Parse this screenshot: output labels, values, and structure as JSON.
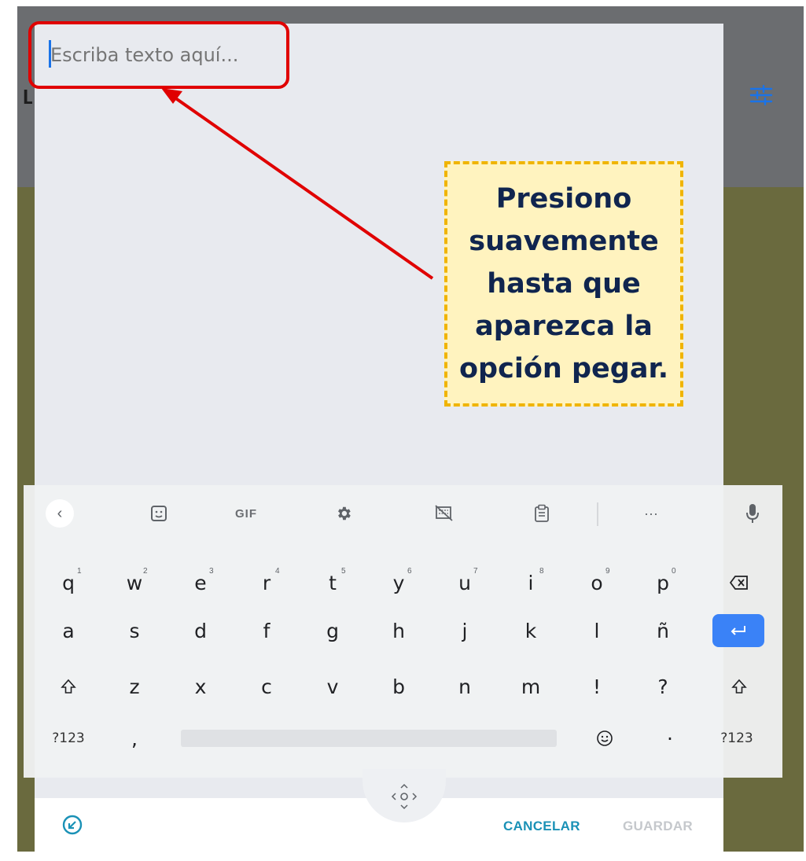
{
  "input": {
    "placeholder": "Escriba texto aquí..."
  },
  "callout": {
    "text": "Presiono suavemente hasta que aparezca la opción pegar."
  },
  "toolbar": {
    "gif_label": "GIF",
    "more_label": "···",
    "icons": [
      "chevron-left-icon",
      "sticker-icon",
      "gif-icon",
      "gear-icon",
      "keyboard-resize-icon",
      "clipboard-icon",
      "more-icon",
      "microphone-icon"
    ]
  },
  "keyboard": {
    "row1": [
      "q",
      "w",
      "e",
      "r",
      "t",
      "y",
      "u",
      "i",
      "o",
      "p"
    ],
    "row1_hints": [
      "1",
      "2",
      "3",
      "4",
      "5",
      "6",
      "7",
      "8",
      "9",
      "0"
    ],
    "row2": [
      "a",
      "s",
      "d",
      "f",
      "g",
      "h",
      "j",
      "k",
      "l",
      "ñ"
    ],
    "row3": [
      "z",
      "x",
      "c",
      "v",
      "b",
      "n",
      "m",
      "!",
      "?"
    ],
    "row4": {
      "symbols_left": "?123",
      "comma": ",",
      "period": "·",
      "symbols_right": "?123"
    }
  },
  "actions": {
    "cancel": "CANCELAR",
    "save": "GUARDAR"
  },
  "colors": {
    "highlight": "#e00000",
    "callout_border": "#f0b400",
    "callout_bg": "#fff3bf",
    "callout_text": "#10254f",
    "enter": "#3a82f7",
    "cancel": "#1a91b6"
  }
}
